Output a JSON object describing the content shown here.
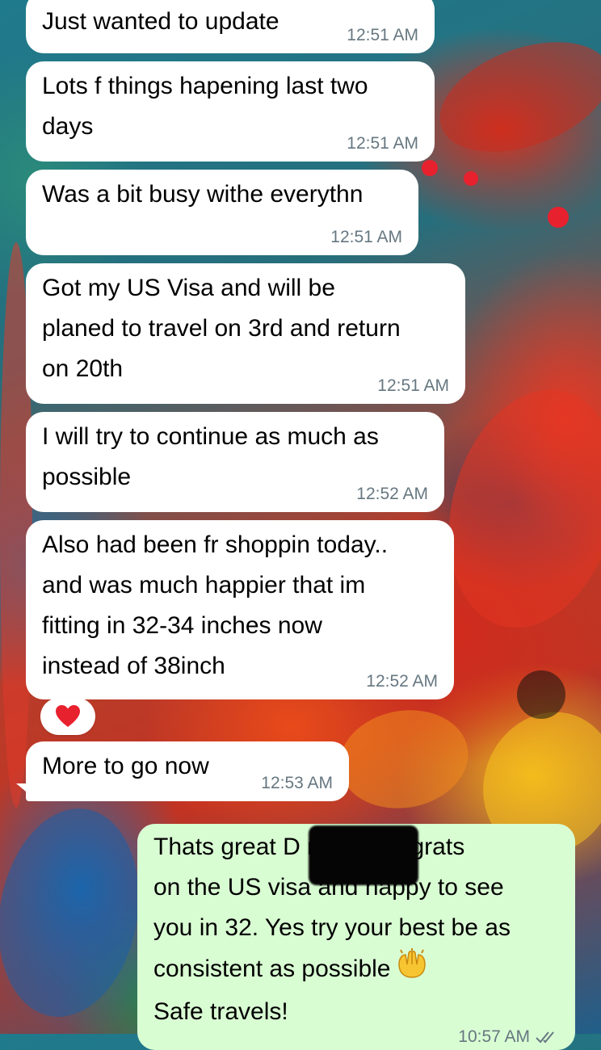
{
  "messages": [
    {
      "text": "Just wanted to update",
      "time": "12:51 AM"
    },
    {
      "text_lines": [
        "Lots f things hapening last two",
        "days"
      ],
      "time": "12:51 AM"
    },
    {
      "text": "Was a bit busy withe everythn",
      "time": "12:51 AM"
    },
    {
      "text_lines": [
        "Got my US Visa and will be",
        "planed to travel on 3rd and return",
        "on 20th"
      ],
      "time": "12:51 AM"
    },
    {
      "text_lines": [
        "I will try to continue as much as",
        "possible"
      ],
      "time": "12:52 AM"
    },
    {
      "text_lines": [
        "Also had been fr shoppin today..",
        "and was much happier that im",
        "fitting in 32-34 inches now",
        "instead of 38inch"
      ],
      "time": "12:52 AM",
      "reaction": "red-heart"
    },
    {
      "text": "More to go now",
      "time": "12:53 AM"
    },
    {
      "text_lines": [
        "Thats great D   nush Congrats",
        "on the US visa and happy to see",
        "you in 32. Yes try your best be as",
        "consistent as possible",
        "Safe travels!"
      ],
      "time": "10:57 AM",
      "status_icon": "double-check-icon",
      "inline_emoji": "raising-hands-emoji"
    }
  ],
  "colors": {
    "incoming_bubble": "#ffffff",
    "outgoing_bubble": "#d9fdd3",
    "timestamp": "#667781",
    "heart": "#e8212e"
  }
}
